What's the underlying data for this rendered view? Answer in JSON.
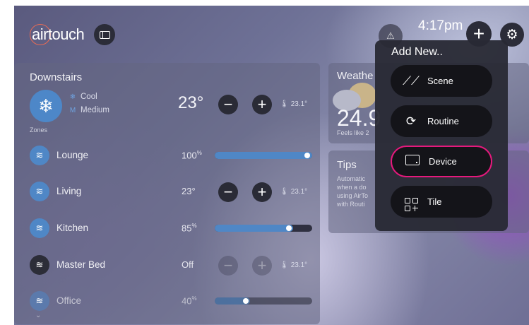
{
  "header": {
    "logo_text": "airtouch",
    "time": "4:17pm",
    "icons": {
      "sidebar": "sidebar-toggle-icon",
      "alert": "alert-icon",
      "add": "plus-icon",
      "settings": "gear-icon"
    }
  },
  "downstairs": {
    "title": "Downstairs",
    "ac": {
      "mode": "Cool",
      "fan": "Medium",
      "fan_symbol": "M",
      "setpoint": "23°",
      "sensor": "23.1°"
    },
    "zones_label": "Zones",
    "zones": [
      {
        "name": "Lounge",
        "value": "100",
        "unit": "%",
        "control": "slider",
        "level": 1.0,
        "state": "on"
      },
      {
        "name": "Living",
        "value": "23°",
        "unit": "",
        "control": "temp",
        "sensor": "23.1°",
        "state": "on"
      },
      {
        "name": "Kitchen",
        "value": "85",
        "unit": "%",
        "control": "slider",
        "level": 0.85,
        "state": "on"
      },
      {
        "name": "Master Bed",
        "value": "Off",
        "unit": "",
        "control": "temp",
        "sensor": "23.1°",
        "state": "off"
      },
      {
        "name": "Office",
        "value": "40",
        "unit": "%",
        "control": "slider",
        "level": 0.4,
        "state": "faded"
      }
    ]
  },
  "weather": {
    "title": "Weathe",
    "temp": "24.9",
    "feels_like": "Feels like 2"
  },
  "tips": {
    "title": "Tips",
    "lines": [
      "Automatic",
      "when a do",
      "using AirTo",
      "with Routi"
    ]
  },
  "add_new_menu": {
    "title": "Add New..",
    "items": [
      {
        "label": "Scene",
        "icon": "scene-icon",
        "selected": false
      },
      {
        "label": "Routine",
        "icon": "routine-icon",
        "selected": false
      },
      {
        "label": "Device",
        "icon": "device-icon",
        "selected": true
      },
      {
        "label": "Tile",
        "icon": "tile-icon",
        "selected": false
      }
    ]
  },
  "colors": {
    "accent_blue": "#4f87c6",
    "selection_pink": "#e6197d",
    "logo_ring": "#e86b55"
  }
}
